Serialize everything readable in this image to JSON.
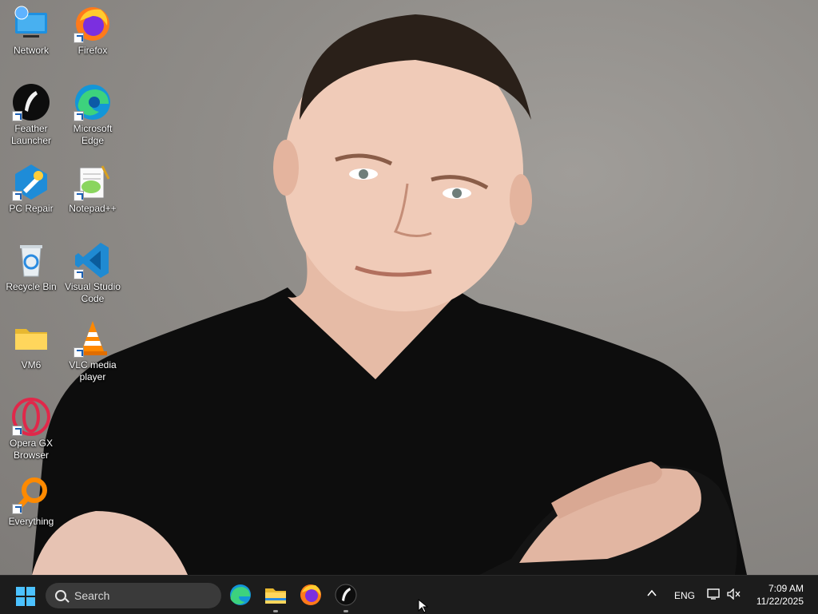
{
  "desktop": {
    "icons": [
      {
        "label": "Network",
        "icon": "network-icon"
      },
      {
        "label": "Firefox",
        "icon": "firefox-icon"
      },
      {
        "label": "Feather Launcher",
        "icon": "feather-launcher-icon"
      },
      {
        "label": "Microsoft Edge",
        "icon": "edge-icon"
      },
      {
        "label": "PC Repair",
        "icon": "pc-repair-icon"
      },
      {
        "label": "Notepad++",
        "icon": "notepadpp-icon"
      },
      {
        "label": "Recycle Bin",
        "icon": "recycle-bin-icon"
      },
      {
        "label": "Visual Studio Code",
        "icon": "vscode-icon"
      },
      {
        "label": "VM6",
        "icon": "folder-icon"
      },
      {
        "label": "VLC media player",
        "icon": "vlc-icon"
      },
      {
        "label": "Opera GX Browser",
        "icon": "opera-gx-icon"
      },
      {
        "label": "Everything",
        "icon": "everything-icon"
      }
    ]
  },
  "taskbar": {
    "search_placeholder": "Search",
    "pinned": [
      "edge-icon",
      "file-explorer-icon",
      "firefox-icon",
      "feather-launcher-icon"
    ],
    "tray": {
      "language": "ENG"
    },
    "clock": {
      "time": "7:09 AM",
      "date": "11/22/2025"
    }
  },
  "colors": {
    "taskbar": "#1c1c1c",
    "start": "#4cc2ff",
    "accent": "#0078d4"
  }
}
